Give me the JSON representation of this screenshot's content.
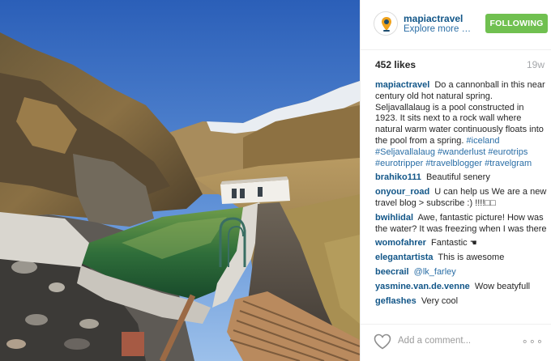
{
  "header": {
    "username": "mapiactravel",
    "subtitle": "Explore more on..",
    "follow_label": "FOLLOWING"
  },
  "post": {
    "likes": "452 likes",
    "age": "19w"
  },
  "caption": {
    "user": "mapiactravel",
    "text": "Do a cannonball in this near century old hot natural spring. Seljavallalaug is a pool constructed in 1923. It sits next to a rock wall where natural warm water continuously floats into the pool from a spring.",
    "tags": "#iceland #Seljavallalaug #wanderlust #eurotrips #eurotripper #travelblogger #travelgram"
  },
  "comments": [
    {
      "user": "brahiko111",
      "text": "Beautiful senery"
    },
    {
      "user": "onyour_road",
      "text": "U can help us We are a new travel blog > subscribe :) !!!!□□"
    },
    {
      "user": "bwihlidal",
      "text": "Awe, fantastic picture! How was the water? It was freezing when I was there"
    },
    {
      "user": "womofahrer",
      "text": "Fantastic",
      "emoji": "☚"
    },
    {
      "user": "elegantartista",
      "text": "This is awesome"
    },
    {
      "user": "beecrail",
      "text": "",
      "mention": "@lk_farley"
    },
    {
      "user": "yasmine.van.de.venne",
      "text": "Wow beatyfull"
    },
    {
      "user": "geflashes",
      "text": "Very cool"
    }
  ],
  "footer": {
    "add_comment_placeholder": "Add a comment...",
    "more_label": "∘∘∘"
  },
  "icons": {
    "avatar": "map-pin-avatar-icon",
    "like": "heart-icon",
    "options": "more-options-icon"
  },
  "colors": {
    "username_blue": "#125688",
    "follow_green": "#70c050",
    "muted_gray": "#a5a7aa"
  }
}
